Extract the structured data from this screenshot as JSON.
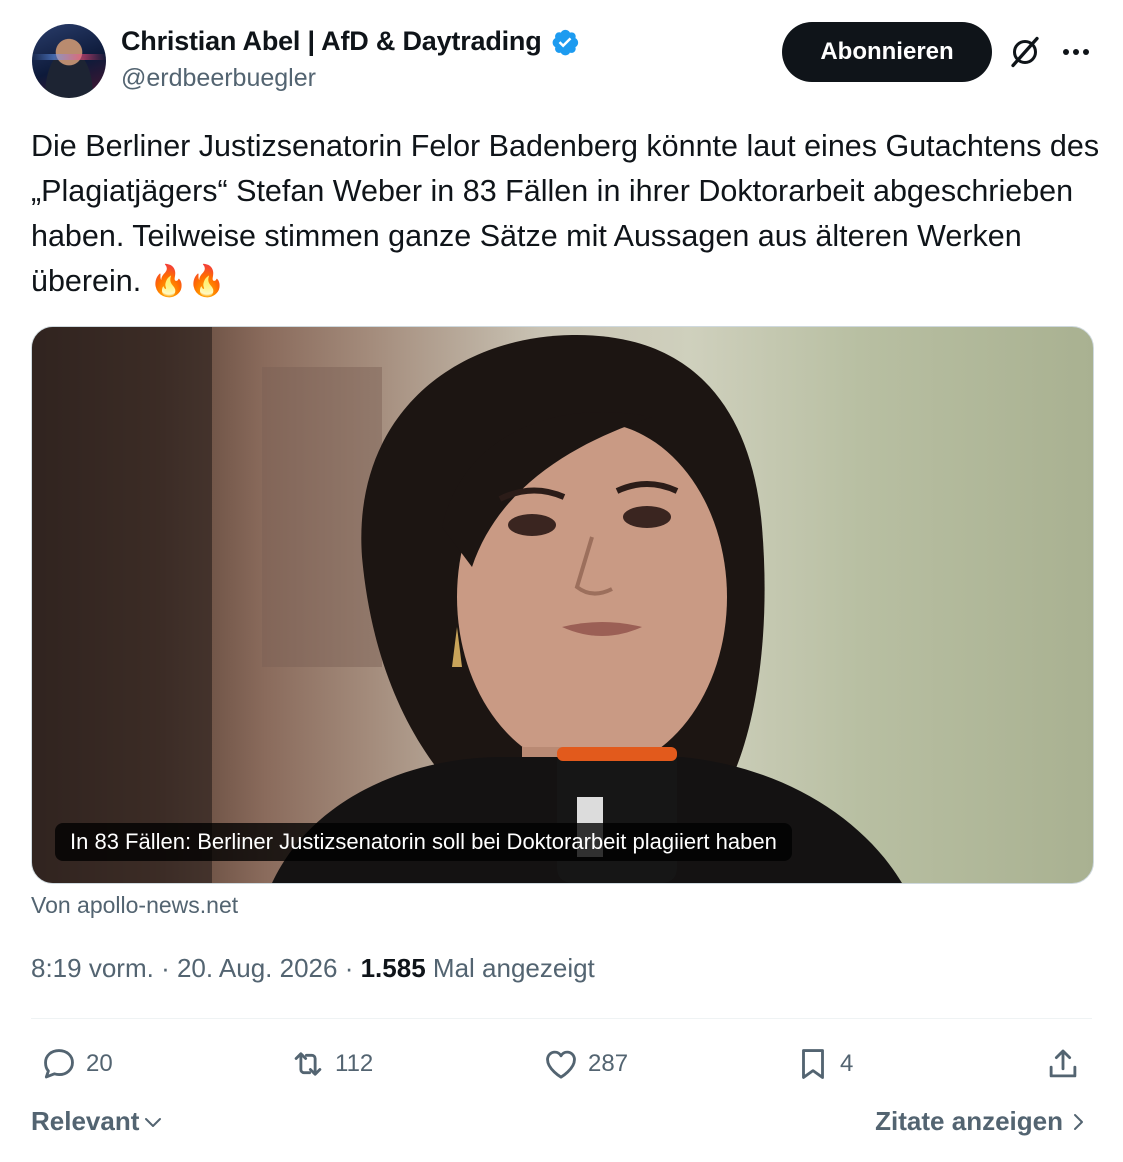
{
  "author": {
    "display_name": "Christian Abel | AfD & Daytrading",
    "handle": "@erdbeerbuegler",
    "verified_color": "#1d9bf0"
  },
  "header": {
    "follow_label": "Abonnieren",
    "grok_icon": "grok-icon",
    "more_icon": "more-icon"
  },
  "tweet": {
    "text": "Die Berliner Justizsenatorin Felor Badenberg könnte laut eines Gutachtens des „Plagiatjägers“ Stefan Weber in 83 Fällen in ihrer Doktorarbeit abgeschrieben haben. Teilweise stimmen ganze Sätze mit Aussagen aus älteren Werken überein. 🔥🔥"
  },
  "link_card": {
    "caption": "In 83 Fällen: Berliner Justizsenatorin soll bei Doktorarbeit plagiiert haben",
    "source": "Von apollo-news.net"
  },
  "meta": {
    "time": "8:19 vorm.",
    "separator": "·",
    "date": "20. Aug. 2026",
    "views_count": "1.585",
    "views_label": "Mal angezeigt"
  },
  "actions": {
    "replies": "20",
    "reposts": "112",
    "likes": "287",
    "bookmarks": "4"
  },
  "footer": {
    "sort_label": "Relevant",
    "quotes_label": "Zitate anzeigen"
  },
  "colors": {
    "text": "#0f1419",
    "secondary": "#536471",
    "button_bg": "#0f1419"
  }
}
